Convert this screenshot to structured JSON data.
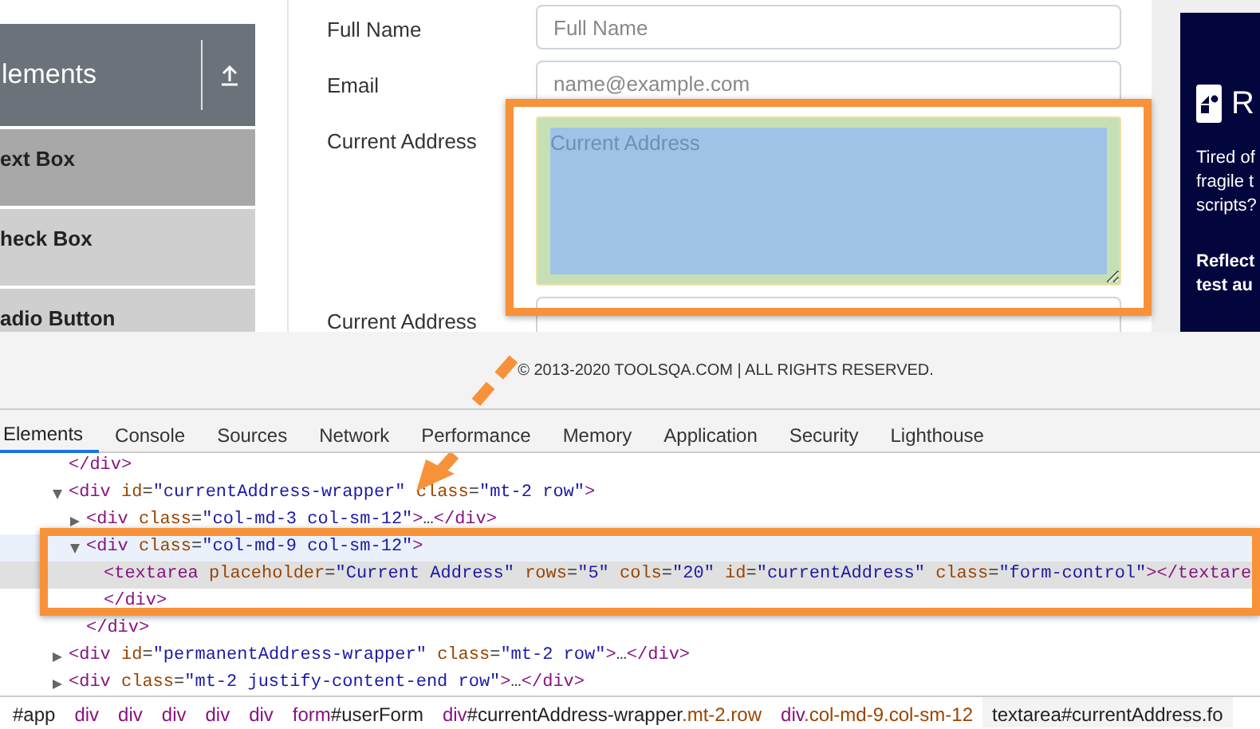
{
  "sidebar": {
    "header": "lements",
    "items": [
      {
        "label": "ext Box",
        "selected": true
      },
      {
        "label": "heck Box",
        "selected": false
      },
      {
        "label": "adio Button",
        "selected": false
      }
    ]
  },
  "form": {
    "fields": [
      {
        "kind": "input",
        "label": "Full Name",
        "placeholder": "Full Name",
        "highlighted": false
      },
      {
        "kind": "input",
        "label": "Email",
        "placeholder": "name@example.com",
        "highlighted": false
      },
      {
        "kind": "textarea",
        "label": "Current Address",
        "placeholder": "Current Address",
        "highlighted": true
      },
      {
        "kind": "input",
        "label": "Current Address",
        "highlighted": false
      }
    ]
  },
  "ad": {
    "title": "R",
    "paragraphs": [
      {
        "kind": "body",
        "lines": [
          "Tired of",
          "fragile t",
          "scripts?"
        ]
      },
      {
        "kind": "headline",
        "lines": [
          "Reflect",
          "test au"
        ]
      }
    ]
  },
  "footer": "© 2013-2020 TOOLSQA.COM | ALL RIGHTS RESERVED.",
  "devtools": {
    "tabs": [
      {
        "label": "Elements",
        "selected": true
      },
      {
        "label": "Console",
        "selected": false
      },
      {
        "label": "Sources",
        "selected": false
      },
      {
        "label": "Network",
        "selected": false
      },
      {
        "label": "Performance",
        "selected": false
      },
      {
        "label": "Memory",
        "selected": false
      },
      {
        "label": "Application",
        "selected": false
      },
      {
        "label": "Security",
        "selected": false
      },
      {
        "label": "Lighthouse",
        "selected": false
      }
    ],
    "dom_tree": [
      {
        "selected": false,
        "hovered": false,
        "tokens": [
          {
            "tag": "</div>"
          }
        ]
      },
      {
        "expanded": true,
        "selected": false,
        "hovered": false,
        "tokens": [
          {
            "tag": "<div"
          },
          {
            "attr": " id"
          },
          {
            "punct": "="
          },
          {
            "value": "\"currentAddress-wrapper\""
          },
          {
            "attr": " class"
          },
          {
            "punct": "="
          },
          {
            "value": "\"mt-2 row\""
          },
          {
            "tag": ">"
          }
        ],
        "children": [
          {
            "expanded": false,
            "selected": false,
            "hovered": false,
            "tokens": [
              {
                "tag": "<div"
              },
              {
                "attr": " class"
              },
              {
                "punct": "="
              },
              {
                "value": "\"col-md-3 col-sm-12\""
              },
              {
                "tag": ">"
              },
              {
                "punct": "…"
              },
              {
                "tag": "</div>"
              }
            ]
          },
          {
            "expanded": true,
            "selected": false,
            "hovered": true,
            "tokens": [
              {
                "tag": "<div"
              },
              {
                "attr": " class"
              },
              {
                "punct": "="
              },
              {
                "value": "\"col-md-9 col-sm-12\""
              },
              {
                "tag": ">"
              }
            ],
            "children": [
              {
                "selected": true,
                "hovered": false,
                "tokens": [
                  {
                    "tag": "<textarea"
                  },
                  {
                    "attr": " placeholder"
                  },
                  {
                    "punct": "="
                  },
                  {
                    "value": "\"Current Address\""
                  },
                  {
                    "attr": " rows"
                  },
                  {
                    "punct": "="
                  },
                  {
                    "value": "\"5\""
                  },
                  {
                    "attr": " cols"
                  },
                  {
                    "punct": "="
                  },
                  {
                    "value": "\"20\""
                  },
                  {
                    "attr": " id"
                  },
                  {
                    "punct": "="
                  },
                  {
                    "value": "\"currentAddress\""
                  },
                  {
                    "attr": " class"
                  },
                  {
                    "punct": "="
                  },
                  {
                    "value": "\"form-control\""
                  },
                  {
                    "tag": "></textare"
                  }
                ]
              },
              {
                "selected": false,
                "hovered": false,
                "tokens": [
                  {
                    "tag": "</div>"
                  }
                ]
              }
            ]
          },
          {
            "selected": false,
            "hovered": false,
            "tokens": [
              {
                "tag": "</div>"
              }
            ]
          }
        ]
      },
      {
        "expanded": false,
        "selected": false,
        "hovered": false,
        "tokens": [
          {
            "tag": "<div"
          },
          {
            "attr": " id"
          },
          {
            "punct": "="
          },
          {
            "value": "\"permanentAddress-wrapper\""
          },
          {
            "attr": " class"
          },
          {
            "punct": "="
          },
          {
            "value": "\"mt-2 row\""
          },
          {
            "tag": ">"
          },
          {
            "punct": "…"
          },
          {
            "tag": "</div>"
          }
        ]
      },
      {
        "expanded": false,
        "selected": false,
        "hovered": false,
        "tokens": [
          {
            "tag": "<div"
          },
          {
            "attr": " class"
          },
          {
            "punct": "="
          },
          {
            "value": "\"mt-2 justify-content-end row\""
          },
          {
            "tag": ">"
          },
          {
            "punct": "…"
          },
          {
            "tag": "</div>"
          }
        ]
      }
    ],
    "breadcrumbs": [
      {
        "selected": false,
        "tokens": [
          {
            "id": "#app"
          }
        ]
      },
      {
        "selected": false,
        "tokens": [
          {
            "tag": "div"
          }
        ]
      },
      {
        "selected": false,
        "tokens": [
          {
            "tag": "div"
          }
        ]
      },
      {
        "selected": false,
        "tokens": [
          {
            "tag": "div"
          }
        ]
      },
      {
        "selected": false,
        "tokens": [
          {
            "tag": "div"
          }
        ]
      },
      {
        "selected": false,
        "tokens": [
          {
            "tag": "div"
          }
        ]
      },
      {
        "selected": false,
        "tokens": [
          {
            "tag": "form"
          },
          {
            "id": "#userForm"
          }
        ]
      },
      {
        "selected": false,
        "tokens": [
          {
            "tag": "div"
          },
          {
            "id": "#currentAddress-wrapper"
          },
          {
            "cls": ".mt-2.row"
          }
        ]
      },
      {
        "selected": false,
        "tokens": [
          {
            "tag": "div"
          },
          {
            "cls": ".col-md-9.col-sm-12"
          }
        ]
      },
      {
        "selected": true,
        "tokens": [
          {
            "tag": "textarea"
          },
          {
            "id": "#currentAddress"
          },
          {
            "cls": ".fo"
          }
        ]
      }
    ]
  }
}
